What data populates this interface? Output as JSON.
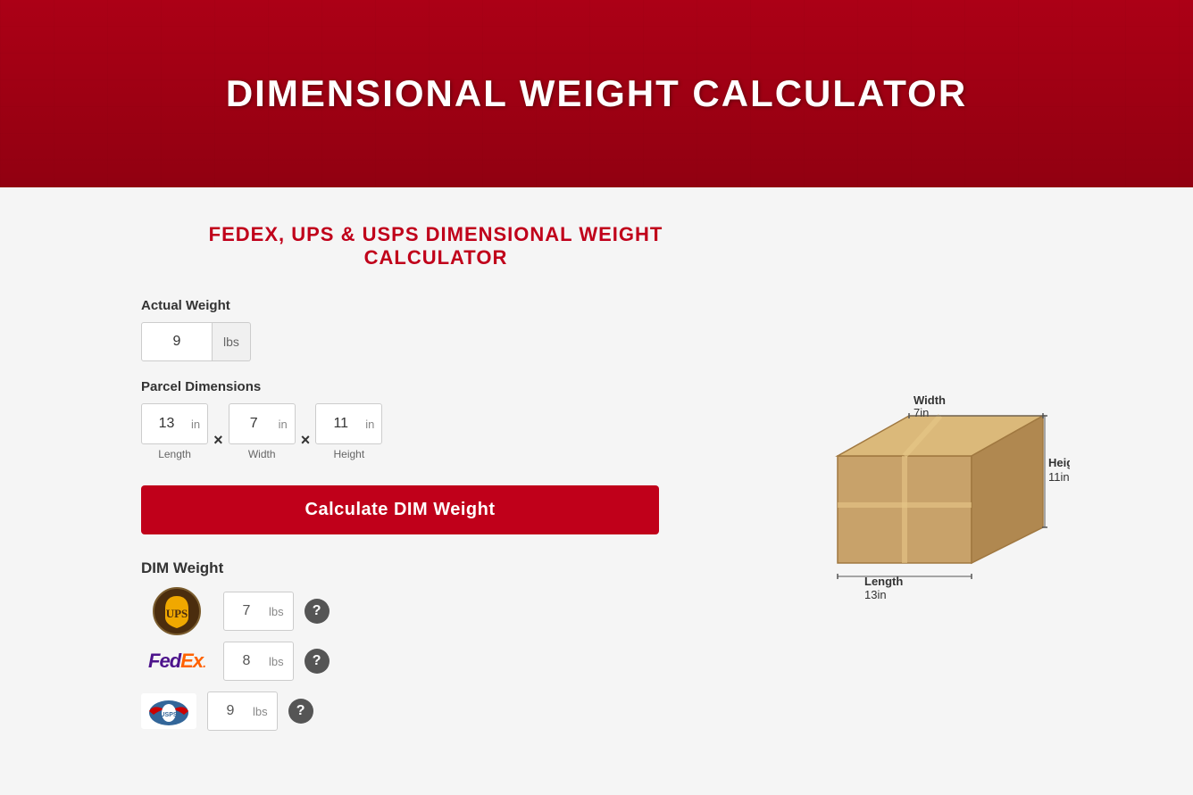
{
  "hero": {
    "title": "DIMENSIONAL WEIGHT CALCULATOR"
  },
  "section_title": "FEDEX, UPS & USPS DIMENSIONAL WEIGHT CALCULATOR",
  "actual_weight": {
    "label": "Actual Weight",
    "value": "9",
    "unit": "lbs"
  },
  "parcel_dimensions": {
    "label": "Parcel Dimensions",
    "length": {
      "value": "13",
      "unit": "in",
      "label": "Length"
    },
    "width": {
      "value": "7",
      "unit": "in",
      "label": "Width"
    },
    "height": {
      "value": "11",
      "unit": "in",
      "label": "Height"
    }
  },
  "calculate_button": "Calculate DIM Weight",
  "dim_weight": {
    "label": "DIM Weight",
    "ups": {
      "value": "7",
      "unit": "lbs"
    },
    "fedex": {
      "value": "8",
      "unit": "lbs"
    },
    "usps": {
      "value": "9",
      "unit": "lbs"
    }
  },
  "box_diagram": {
    "width_label": "Width",
    "width_val": "7in",
    "height_label": "Height",
    "height_val": "11in",
    "length_label": "Length",
    "length_val": "13in"
  }
}
